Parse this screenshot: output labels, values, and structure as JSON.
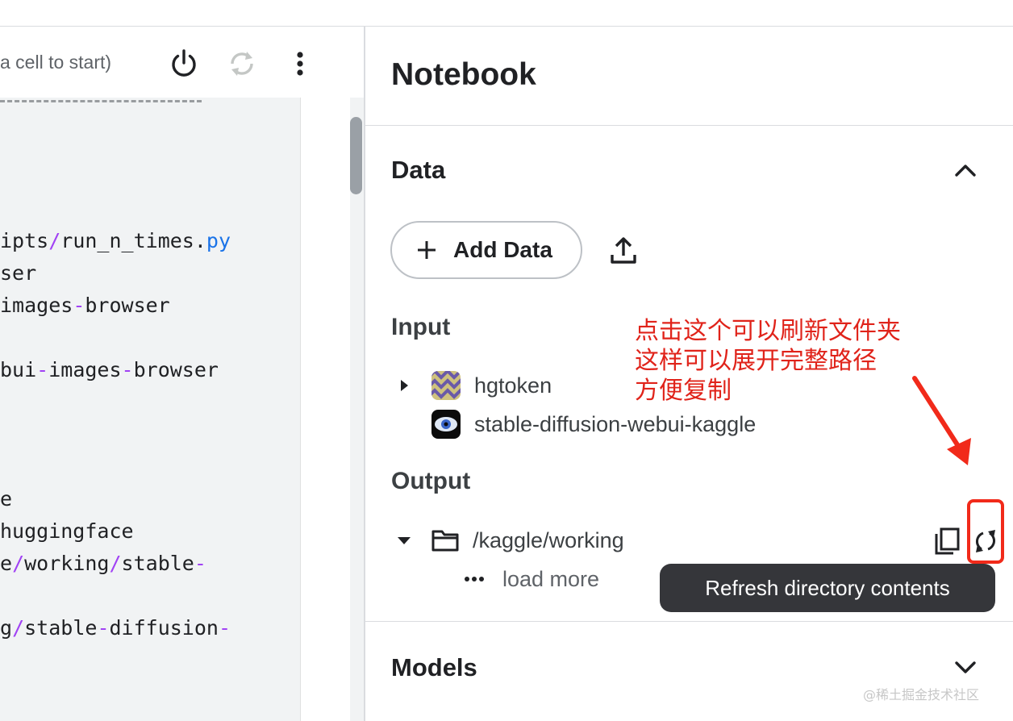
{
  "editor": {
    "status_text": "a cell to start)",
    "icons": {
      "power": "power-icon",
      "restart": "restart-icon",
      "more": "more-vert-icon"
    },
    "code_lines": [
      {
        "parts": [
          {
            "t": "ipts"
          },
          {
            "t": "/",
            "c": "pu"
          },
          {
            "t": "run_n_times."
          },
          {
            "t": "py",
            "c": "bl"
          }
        ]
      },
      {
        "parts": [
          {
            "t": "ser"
          }
        ]
      },
      {
        "parts": [
          {
            "t": "images"
          },
          {
            "t": "-",
            "c": "pu"
          },
          {
            "t": "browser"
          }
        ]
      },
      {
        "parts": [
          {
            "t": "bui"
          },
          {
            "t": "-",
            "c": "pu"
          },
          {
            "t": "images"
          },
          {
            "t": "-",
            "c": "pu"
          },
          {
            "t": "browser"
          }
        ]
      },
      {
        "parts": [
          {
            "t": "e"
          }
        ]
      },
      {
        "parts": [
          {
            "t": "huggingface"
          }
        ]
      },
      {
        "parts": [
          {
            "t": "e"
          },
          {
            "t": "/",
            "c": "pu"
          },
          {
            "t": "working"
          },
          {
            "t": "/",
            "c": "pu"
          },
          {
            "t": "stable"
          },
          {
            "t": "-",
            "c": "pu"
          }
        ]
      },
      {
        "parts": [
          {
            "t": "g"
          },
          {
            "t": "/",
            "c": "pu"
          },
          {
            "t": "stable"
          },
          {
            "t": "-",
            "c": "pu"
          },
          {
            "t": "diffusion"
          },
          {
            "t": "-",
            "c": "pu"
          }
        ]
      }
    ]
  },
  "panel": {
    "title": "Notebook",
    "data_section": {
      "title": "Data",
      "add_data_label": "Add Data",
      "input_label": "Input",
      "inputs": [
        {
          "name": "hgtoken"
        },
        {
          "name": "stable-diffusion-webui-kaggle"
        }
      ],
      "output_label": "Output",
      "output_path": "/kaggle/working",
      "load_more_label": "load more",
      "tooltip": "Refresh directory contents"
    },
    "models_section": {
      "title": "Models"
    }
  },
  "annotation": {
    "lines": [
      "点击这个可以刷新文件夹",
      "这样可以展开完整路径",
      "方便复制"
    ],
    "color": "#e0231a"
  },
  "watermark": "@稀土掘金技术社区",
  "colors": {
    "accent_purple": "#a142f4",
    "accent_blue": "#1a73e8",
    "annotation_red": "#f12a1a",
    "tooltip_bg": "#35363a"
  }
}
